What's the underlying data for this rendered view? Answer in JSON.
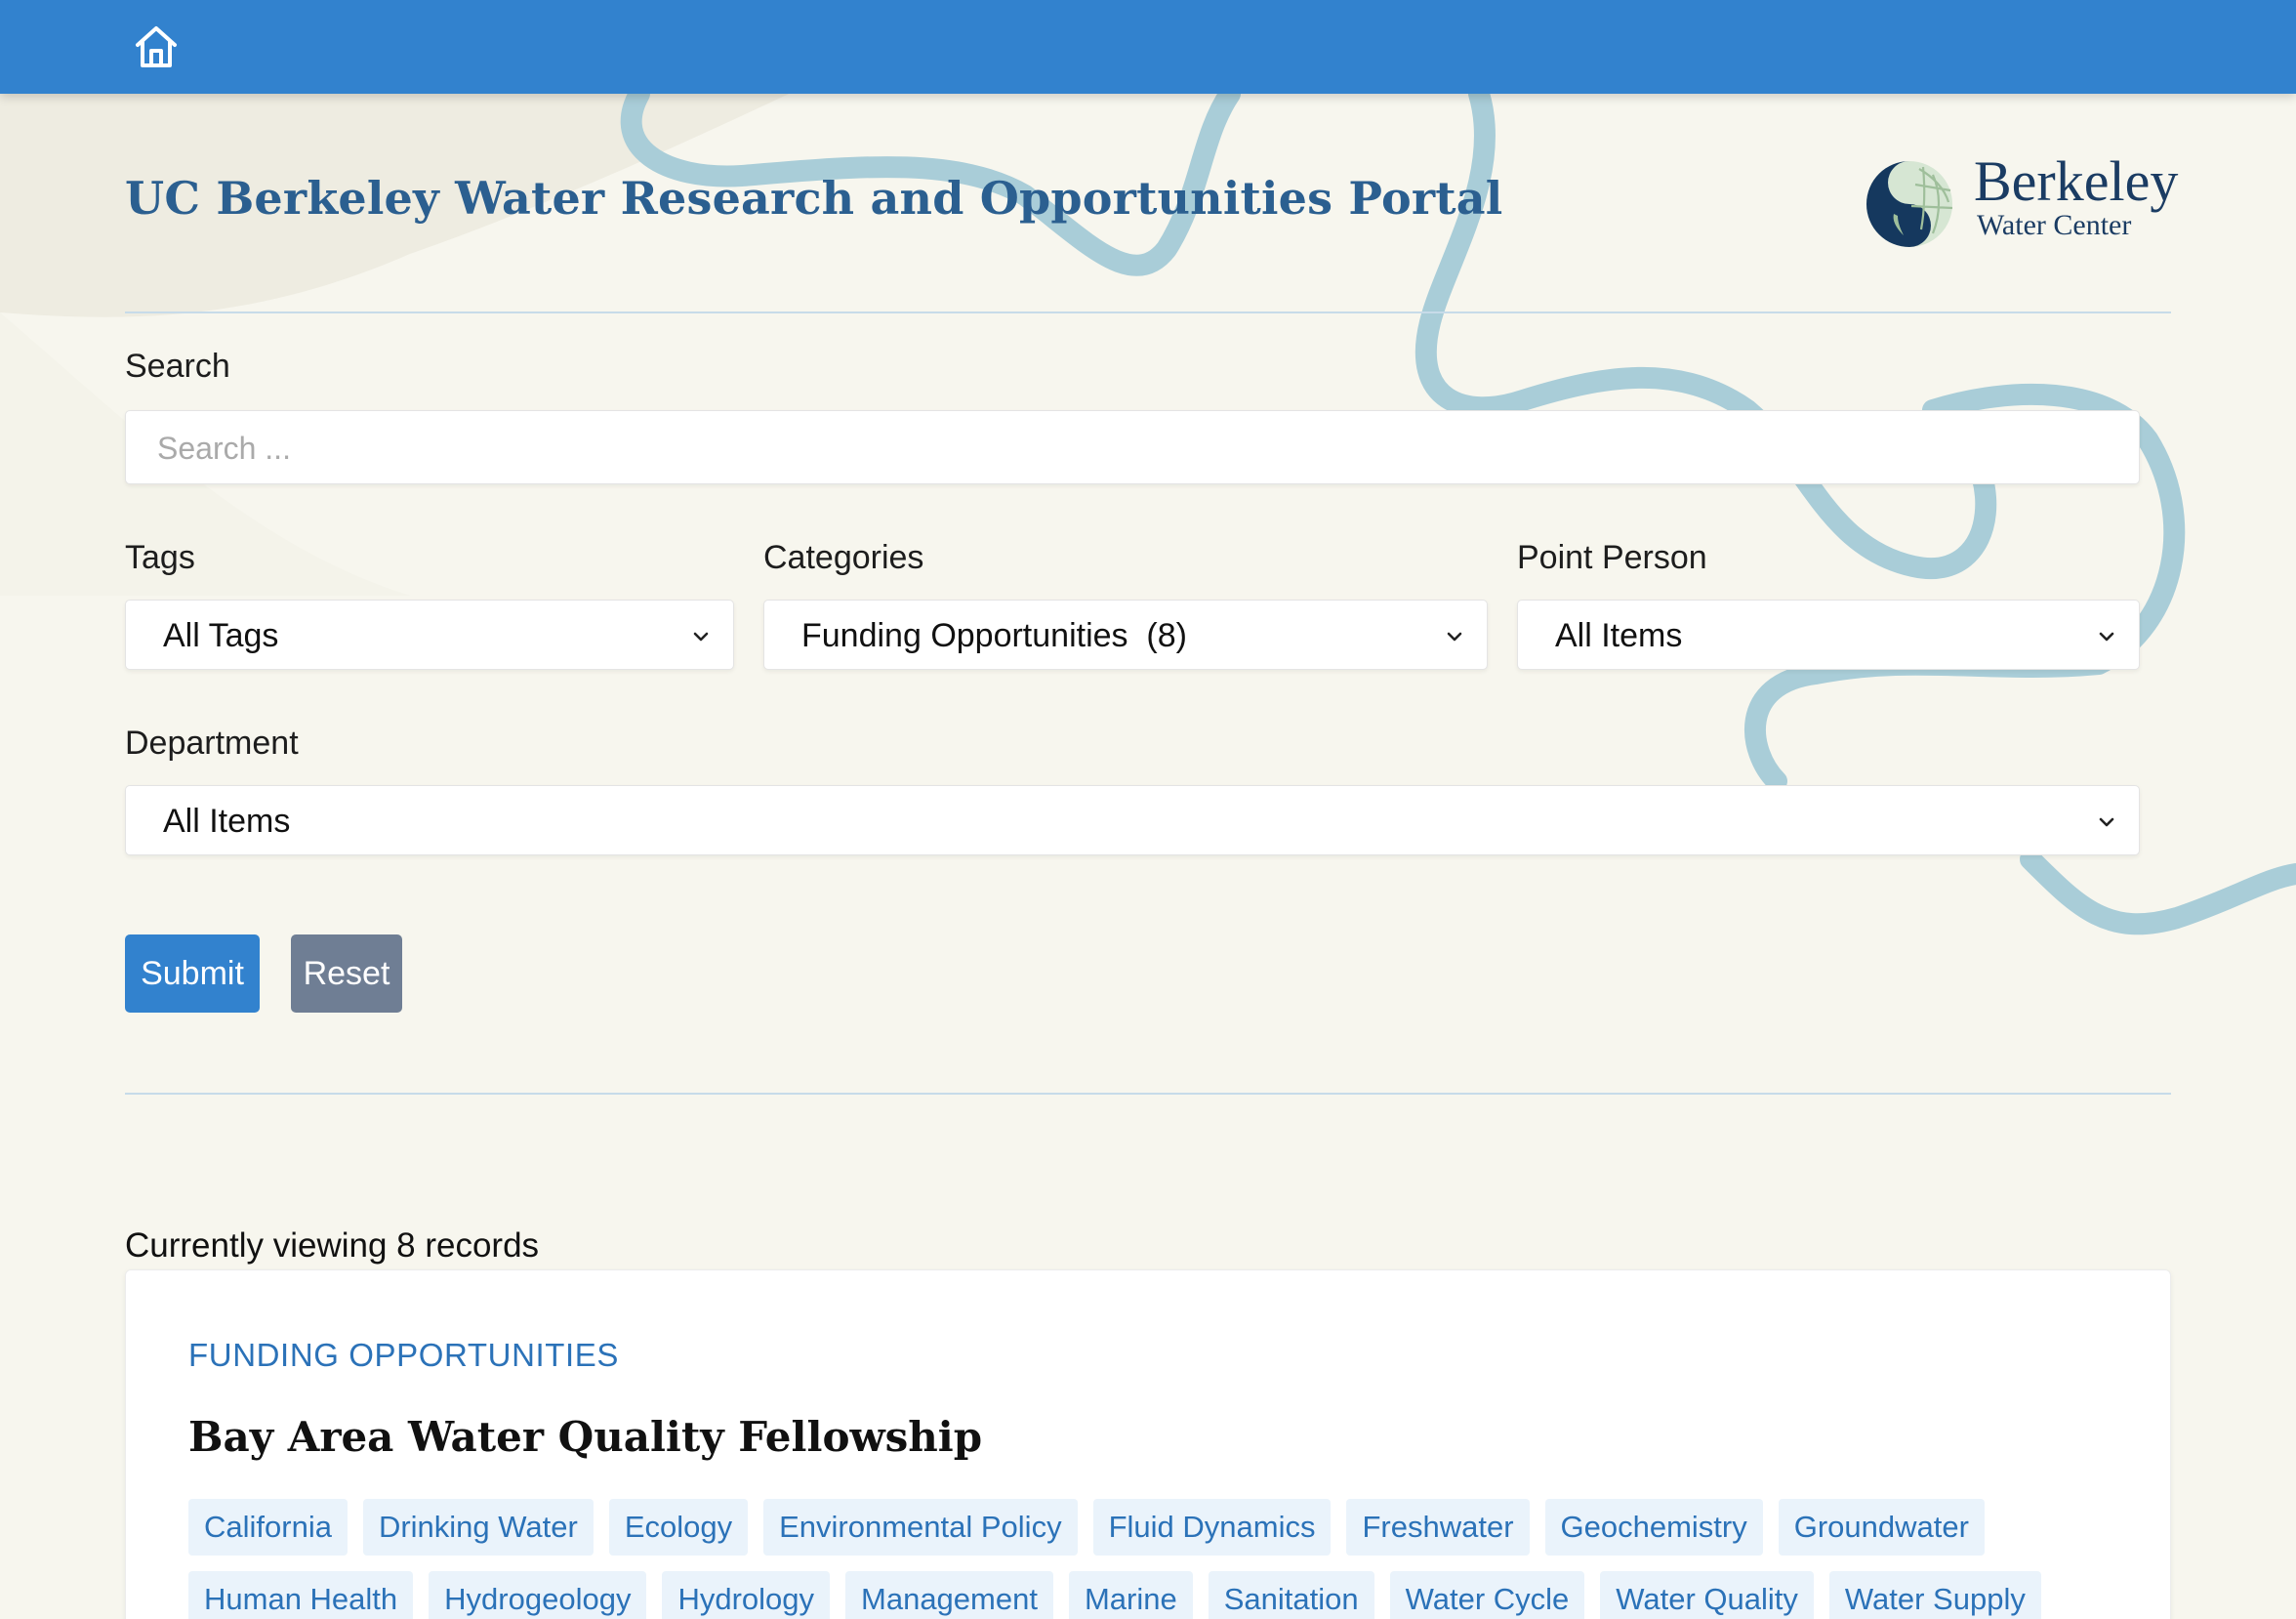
{
  "header": {
    "home_icon": "home-icon"
  },
  "page_title": "UC Berkeley Water Research and Opportunities Portal",
  "logo": {
    "line1": "Berkeley",
    "line2": "Water Center"
  },
  "search": {
    "label": "Search",
    "placeholder": "Search ..."
  },
  "filters": {
    "tags": {
      "label": "Tags",
      "value": "All Tags"
    },
    "categories": {
      "label": "Categories",
      "value": "Funding Opportunities  (8)"
    },
    "point_person": {
      "label": "Point Person",
      "value": "All Items"
    },
    "department": {
      "label": "Department",
      "value": "All Items"
    }
  },
  "buttons": {
    "submit": "Submit",
    "reset": "Reset"
  },
  "results": {
    "count_text": "Currently viewing 8 records",
    "card": {
      "category": "FUNDING OPPORTUNITIES",
      "title": "Bay Area Water Quality Fellowship",
      "tag_rows": [
        [
          "California",
          "Drinking Water",
          "Ecology",
          "Environmental Policy",
          "Fluid Dynamics",
          "Freshwater",
          "Geochemistry",
          "Groundwater"
        ],
        [
          "Human Health",
          "Hydrogeology",
          "Hydrology",
          "Management",
          "Marine",
          "Sanitation",
          "Water Cycle",
          "Water Quality",
          "Water Supply"
        ]
      ]
    }
  },
  "colors": {
    "topbar": "#3282ce",
    "accent": "#2b72b8",
    "title": "#2b5f90",
    "river": "#a9cdd8",
    "reset": "#6f7e94"
  }
}
